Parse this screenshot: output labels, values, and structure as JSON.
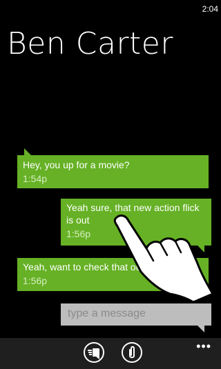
{
  "status": {
    "time": "2:04"
  },
  "header": {
    "contact_name": "Ben Carter"
  },
  "messages": [
    {
      "direction": "incoming",
      "text": "Hey, you up for a movie?",
      "time": "1:54p"
    },
    {
      "direction": "outgoing",
      "text": "Yeah sure, that new action flick is out",
      "time": "1:56p"
    },
    {
      "direction": "incoming",
      "text": "Yeah, want to check that out",
      "time": "1:56p"
    }
  ],
  "composer": {
    "placeholder": "type a message"
  },
  "appbar": {
    "buttons": [
      {
        "icon": "send-icon"
      },
      {
        "icon": "attach-paperclip-icon"
      }
    ],
    "more_icon": "ellipsis-icon"
  },
  "colors": {
    "background": "#000000",
    "bubble": "#66b125",
    "input": "#bdbdbd",
    "appbar": "#1f1f1f"
  }
}
